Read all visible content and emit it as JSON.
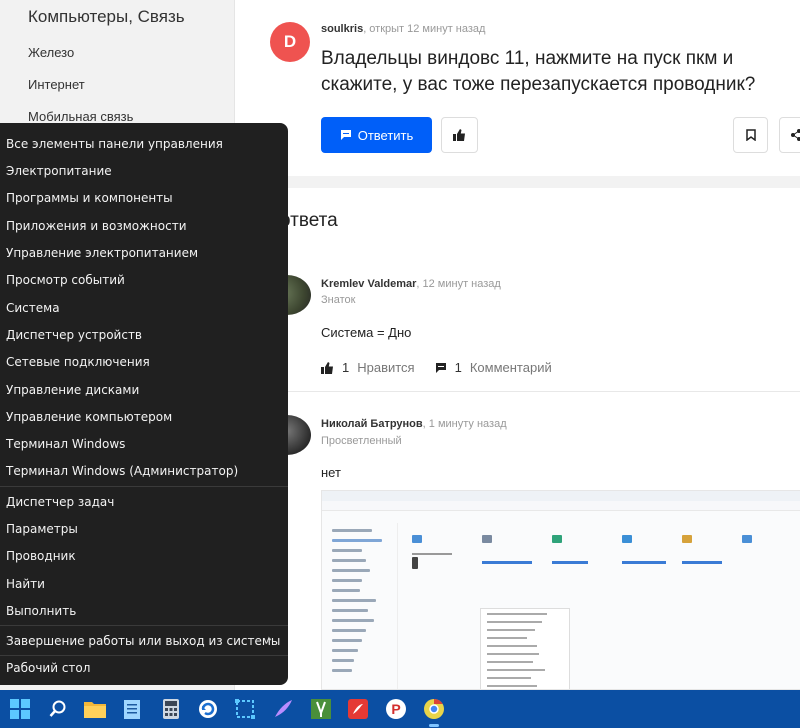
{
  "sidebar": {
    "title": "Компьютеры, Связь",
    "items": [
      "Железо",
      "Интернет",
      "Мобильная связь"
    ]
  },
  "question": {
    "avatar_letter": "D",
    "author": "soulkris",
    "meta": ", открыт 12 минут назад",
    "title": "Владельцы виндовс 11, нажмите на пуск пкм и скажите, у вас тоже перезапускается проводник?",
    "answer_button": "Ответить"
  },
  "answers": {
    "heading": "ответа",
    "list": [
      {
        "author": "Kremlev Valdemar",
        "meta": ", 12 минут назад",
        "rank": "Знаток",
        "text": "Система = Дно",
        "likes": "1",
        "like_label": "Нравится",
        "comments": "1",
        "comment_label": "Комментарий"
      },
      {
        "author": "Николай Батрунов",
        "meta": ", 1 минуту назад",
        "rank": "Просветленный",
        "text": "нет"
      }
    ]
  },
  "context_menu": {
    "group1": [
      "Все элементы панели управления",
      "Электропитание",
      "Программы и компоненты",
      "Приложения и возможности",
      "Управление электропитанием",
      "Просмотр событий",
      "Система",
      "Диспетчер устройств",
      "Сетевые подключения",
      "Управление дисками",
      "Управление компьютером",
      "Терминал Windows",
      "Терминал Windows (Администратор)"
    ],
    "group2": [
      "Диспетчер задач",
      "Параметры",
      "Проводник",
      "Найти",
      "Выполнить"
    ],
    "group3": [
      "Завершение работы или выход из системы"
    ],
    "group4": [
      "Рабочий стол"
    ],
    "submenu_arrow": "›"
  },
  "colors": {
    "accent": "#005ff9",
    "taskbar": "#0b4fa3",
    "menu_bg": "#202020",
    "avatar": "#ef5350"
  },
  "taskbar_icons": [
    "windows-start-icon",
    "search-icon",
    "file-explorer-icon",
    "notepad-icon",
    "calculator-icon",
    "update-icon",
    "snipping-icon",
    "feather-icon",
    "sysinternals-icon",
    "pdf-icon",
    "chrome-icon"
  ]
}
